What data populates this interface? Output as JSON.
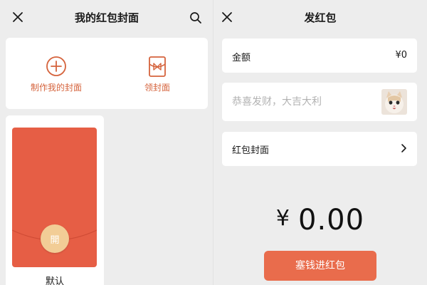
{
  "left_screen": {
    "title": "我的红包封面",
    "actions": [
      {
        "label": "制作我的封面",
        "icon": "plus-circle-icon"
      },
      {
        "label": "领封面",
        "icon": "gift-envelope-icon"
      }
    ],
    "covers": [
      {
        "name": "默认",
        "seal_glyph": "開"
      }
    ]
  },
  "right_screen": {
    "title": "发红包",
    "amount": {
      "label": "金额",
      "value": "¥0"
    },
    "wish": {
      "placeholder": "恭喜发财，大吉大利",
      "sticker": "cat-sticker"
    },
    "cover_row": {
      "label": "红包封面"
    },
    "total": {
      "symbol": "¥",
      "value": "0.00"
    },
    "submit_label": "塞钱进红包"
  },
  "colors": {
    "accent": "#d5633c",
    "envelope": "#e65e45",
    "seal": "#f2cd96",
    "button": "#e96c4c",
    "background": "#ededed"
  }
}
